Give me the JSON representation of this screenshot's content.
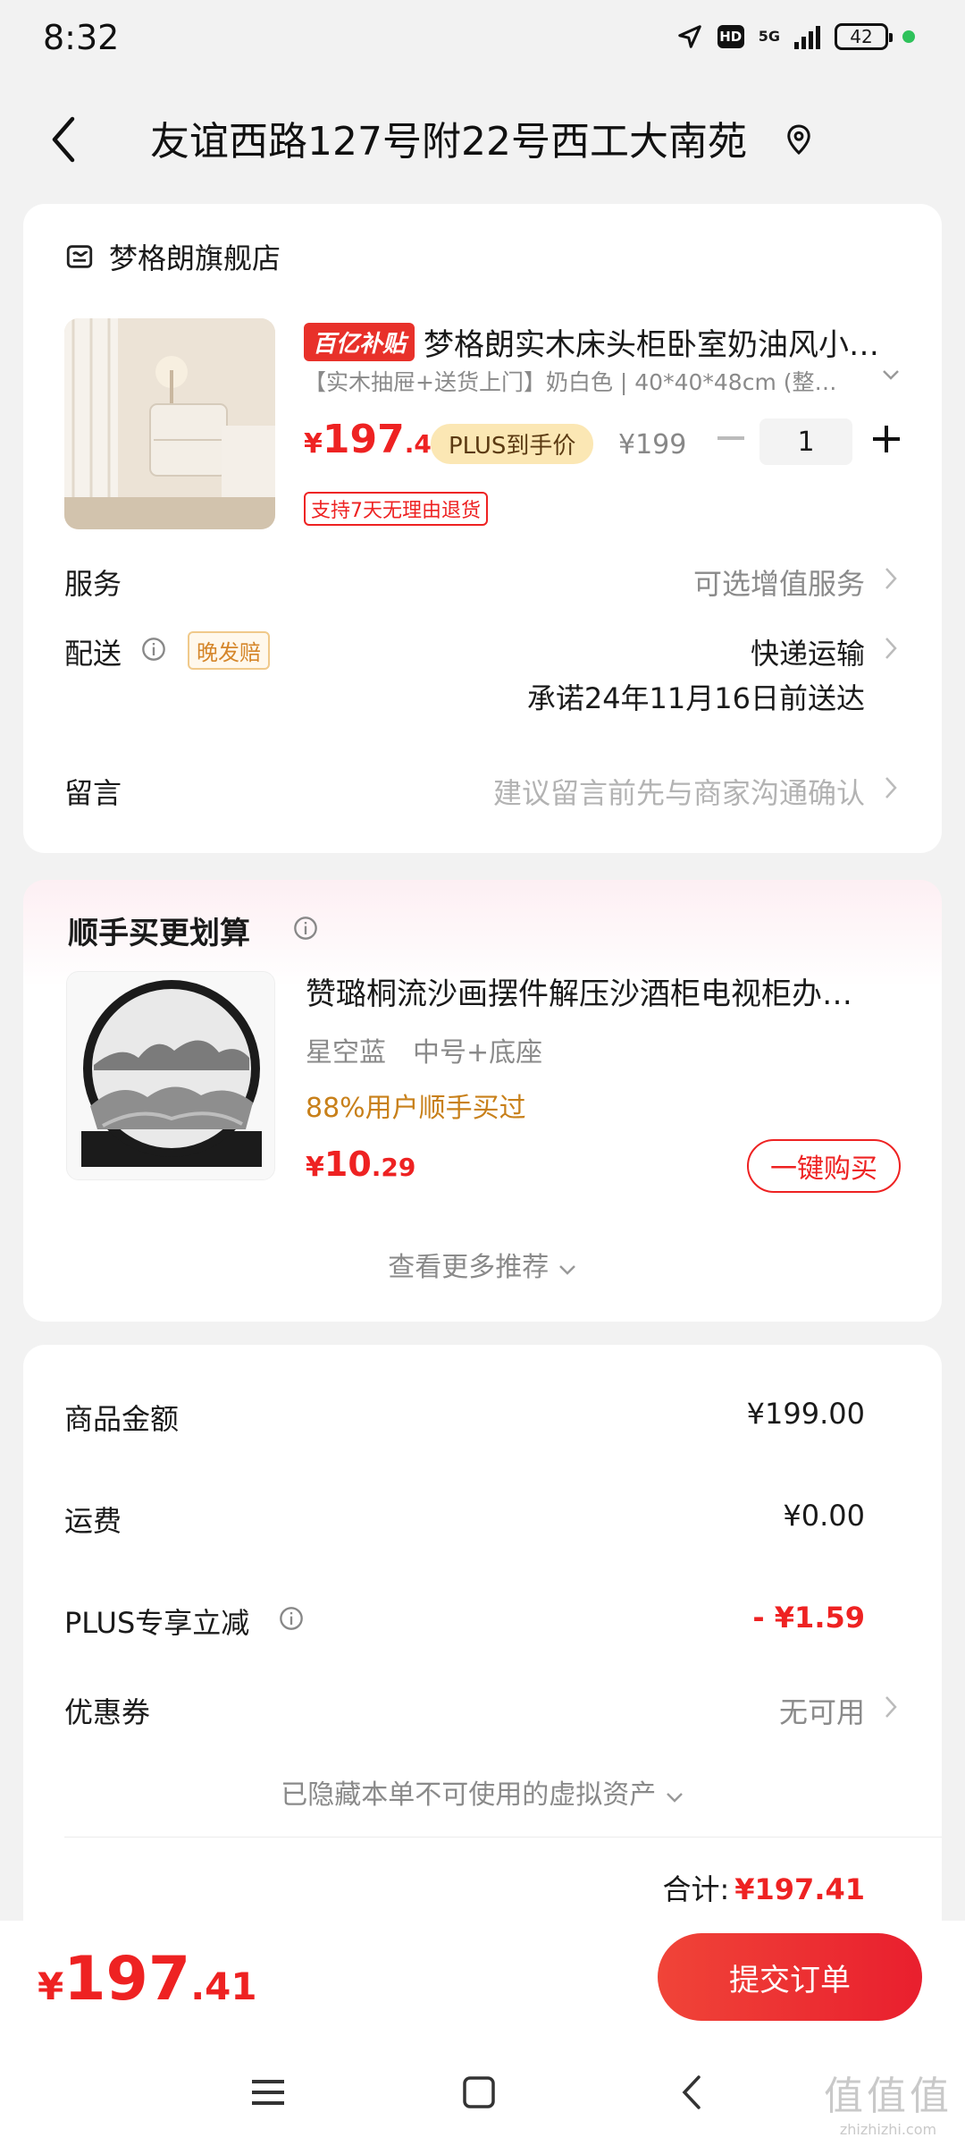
{
  "status": {
    "time": "8:32",
    "network": "5G",
    "hd": "HD",
    "battery": "42"
  },
  "header": {
    "address": "友谊西路127号附22号西工大南苑"
  },
  "order_item": {
    "shop_name": "梦格朗旗舰店",
    "subsidy_badge": "百亿补贴",
    "title": "梦格朗实木床头柜卧室奶油风小…",
    "spec": "【实木抽屉+送货上门】奶白色 | 40*40*48cm (整…",
    "price_symbol": "¥",
    "price_int": "197",
    "price_dec": ".41",
    "plus_badge": "PLUS到手价",
    "original_price": "¥199",
    "quantity": "1",
    "return_tag": "支持7天无理由退货"
  },
  "service": {
    "label": "服务",
    "value": "可选增值服务"
  },
  "delivery": {
    "label": "配送",
    "late_tag": "晚发赔",
    "method": "快递运输",
    "promise": "承诺24年11月16日前送达"
  },
  "message": {
    "label": "留言",
    "placeholder": "建议留言前先与商家沟通确认"
  },
  "recommend": {
    "title": "顺手买更划算",
    "item_title": "赞璐桐流沙画摆件解压沙酒柜电视柜办…",
    "spec_color": "星空蓝",
    "spec_size": "中号+底座",
    "stat": "88%用户顺手买过",
    "price_symbol": "¥",
    "price_int": "10",
    "price_dec": ".29",
    "buy_label": "一键购买",
    "see_more": "查看更多推荐"
  },
  "summary": {
    "goods_label": "商品金额",
    "goods_value": "¥199.00",
    "shipping_label": "运费",
    "shipping_value": "¥0.00",
    "plus_label": "PLUS专享立减",
    "plus_value": "- ¥1.59",
    "coupon_label": "优惠券",
    "coupon_value": "无可用",
    "hidden_assets": "已隐藏本单不可使用的虚拟资产",
    "total_label": "合计:",
    "total_value": "¥197.41"
  },
  "bottom": {
    "price_symbol": "¥",
    "price_int": "197",
    "price_dec": ".41",
    "submit_label": "提交订单"
  },
  "watermark": {
    "logo": "值值值",
    "site": "zhizhizhi.com"
  },
  "colors": {
    "accent_red": "#e22222",
    "plus_gold": "#fbe7b4",
    "stat_orange": "#c8801a"
  }
}
